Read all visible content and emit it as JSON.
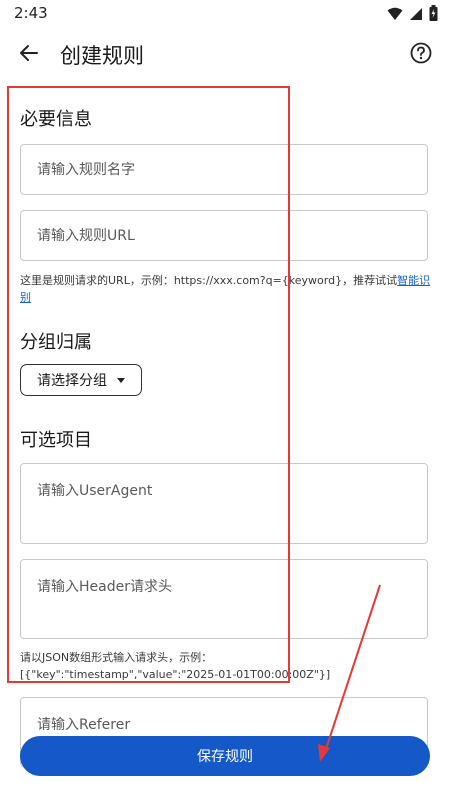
{
  "status_bar": {
    "time": "2:43"
  },
  "header": {
    "title": "创建规则"
  },
  "sections": {
    "required": "必要信息",
    "group": "分组归属",
    "optional": "可选项目"
  },
  "fields": {
    "name_placeholder": "请输入规则名字",
    "url_placeholder": "请输入规则URL",
    "useragent_placeholder": "请输入UserAgent",
    "header_placeholder": "请输入Header请求头",
    "referer_placeholder": "请输入Referer"
  },
  "helpers": {
    "url_hint": "这里是规则请求的URL，示例：https://xxx.com?q={keyword}，推荐试试",
    "url_hint_link": "智能识别",
    "header_hint_line1": "请以JSON数组形式输入请求头，示例：",
    "header_hint_line2": "[{\"key\":\"timestamp\",\"value\":\"2025-01-01T00:00:00Z\"}]"
  },
  "group_select": {
    "value": "请选择分组"
  },
  "actions": {
    "save_label": "保存规则"
  },
  "icons": {
    "back": "arrow-back-icon",
    "help": "help-circle-icon",
    "wifi": "wifi-icon",
    "signal": "signal-icon",
    "battery": "battery-icon",
    "dropdown": "caret-down-icon"
  },
  "colors": {
    "accent": "#1558c8",
    "link": "#1a62d6",
    "annotation": "#e53935"
  }
}
